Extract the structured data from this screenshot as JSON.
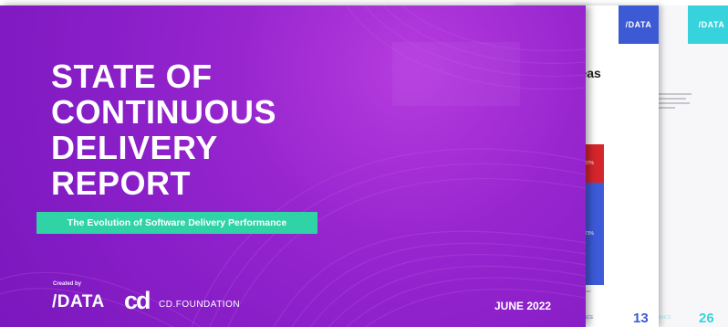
{
  "back_page": {
    "brand": "/DATA",
    "heading": "p",
    "page_number": "26",
    "footer_label": "ANCE"
  },
  "middle_page": {
    "brand": "/DATA",
    "heading": "reas",
    "bar_top_label": "37%",
    "bar_bottom_label": "73%",
    "bar_caption": "lance",
    "page_number": "13",
    "footer_label": "NCE"
  },
  "cover": {
    "title_lines": [
      "STATE OF",
      "CONTINUOUS",
      "DELIVERY",
      "REPORT"
    ],
    "subtitle": "The Evolution of Software Delivery Performance",
    "created_by": "Created by",
    "logo_data": "/DATA",
    "logo_cd_mark": "cd",
    "logo_cd_text": "CD.FOUNDATION",
    "date": "JUNE 2022"
  },
  "colors": {
    "cover_purple": "#8a1fc8",
    "subtitle_green": "#2fd3a6",
    "middle_accent": "#3c5ad3",
    "back_accent": "#37d3dc",
    "bar_red": "#d6262b"
  }
}
